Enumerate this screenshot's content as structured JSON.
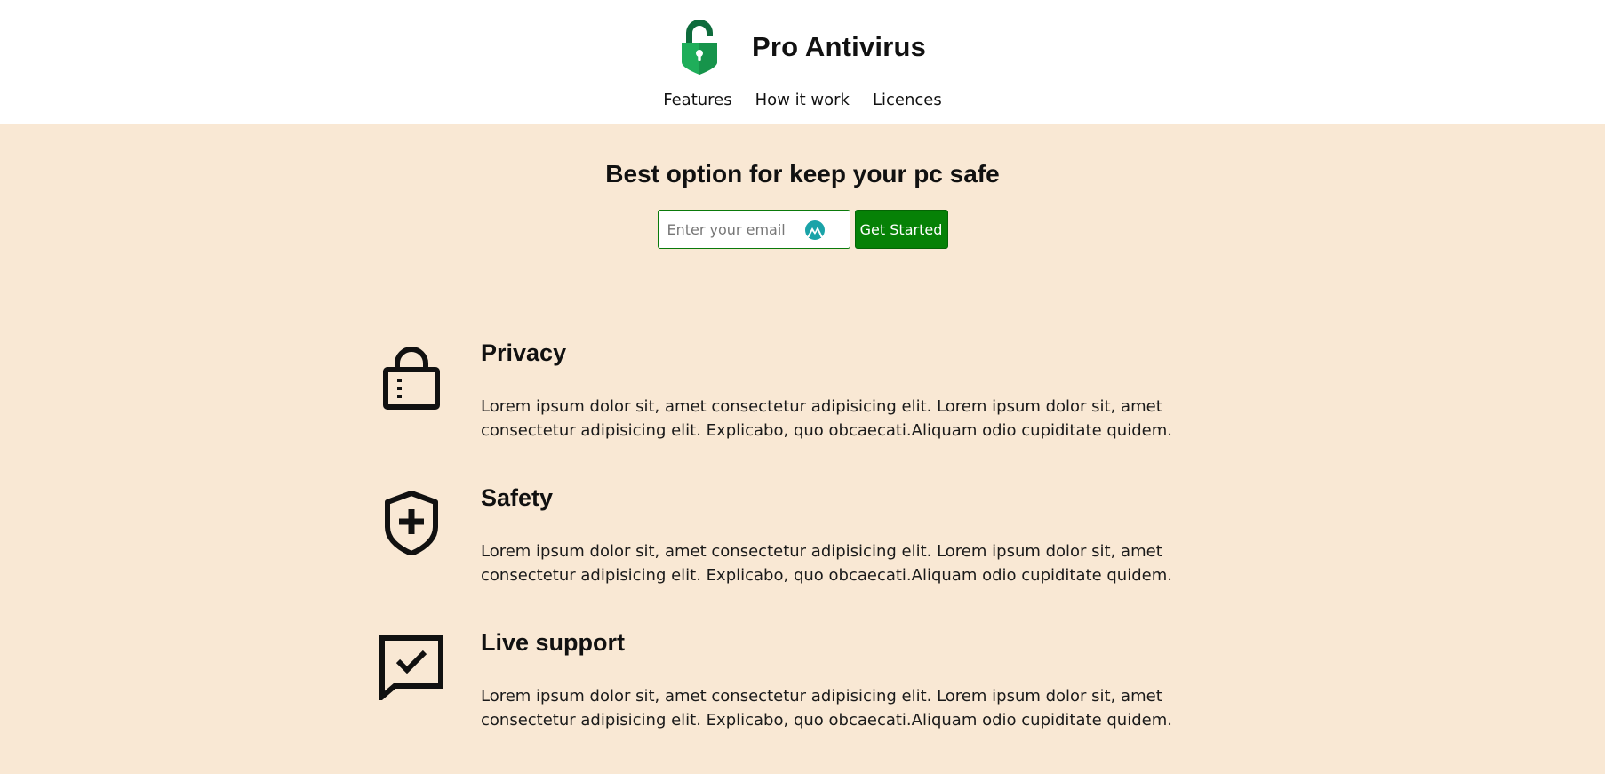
{
  "header": {
    "brand_title": "Pro Antivirus",
    "logo_icon": "padlock-logo-icon",
    "nav": [
      {
        "label": "Features"
      },
      {
        "label": "How it work"
      },
      {
        "label": "Licences"
      }
    ]
  },
  "hero": {
    "title": "Best option for keep your pc safe",
    "email_placeholder": "Enter your email",
    "email_value": "",
    "email_extension_icon": "vpn-extension-icon",
    "cta_label": "Get Started"
  },
  "features": [
    {
      "icon": "lock-icon",
      "title": "Privacy",
      "text": "Lorem ipsum dolor sit, amet consectetur adipisicing elit. Lorem ipsum dolor sit, amet consectetur adipisicing elit. Explicabo, quo obcaecati.Aliquam odio cupiditate quidem."
    },
    {
      "icon": "shield-plus-icon",
      "title": "Safety",
      "text": "Lorem ipsum dolor sit, amet consectetur adipisicing elit. Lorem ipsum dolor sit, amet consectetur adipisicing elit. Explicabo, quo obcaecati.Aliquam odio cupiditate quidem."
    },
    {
      "icon": "chat-check-icon",
      "title": "Live support",
      "text": "Lorem ipsum dolor sit, amet consectetur adipisicing elit. Lorem ipsum dolor sit, amet consectetur adipisicing elit. Explicabo, quo obcaecati.Aliquam odio cupiditate quidem."
    }
  ],
  "colors": {
    "header_bg": "#ffffff",
    "page_bg": "#f9e8d4",
    "accent_green": "#068106",
    "logo_green": "#1fae5a",
    "logo_dark_green": "#0e6b3c",
    "extension_teal": "#1aa3a8"
  }
}
